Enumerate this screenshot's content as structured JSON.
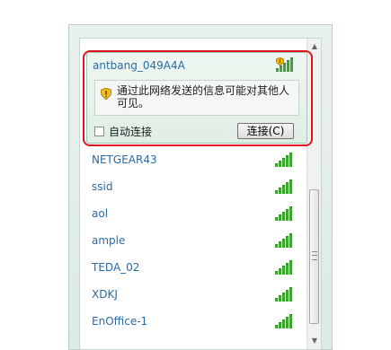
{
  "selected_network": {
    "ssid": "antbang_049A4A",
    "warning": "通过此网络发送的信息可能对其他人可见。",
    "auto_connect_label": "自动连接",
    "connect_button": "连接(C)",
    "auto_connect_checked": false
  },
  "networks": [
    {
      "ssid": "NETGEAR43"
    },
    {
      "ssid": "ssid"
    },
    {
      "ssid": "aol"
    },
    {
      "ssid": "ample"
    },
    {
      "ssid": "TEDA_02"
    },
    {
      "ssid": "XDKJ"
    },
    {
      "ssid": "EnOffice-1"
    }
  ],
  "colors": {
    "signal": "#3fa532",
    "highlight_border": "#e0141e",
    "ssid_text": "#2a6aa3"
  },
  "icons": {
    "warning": "shield-warning-icon",
    "signal": "wifi-signal-icon"
  }
}
